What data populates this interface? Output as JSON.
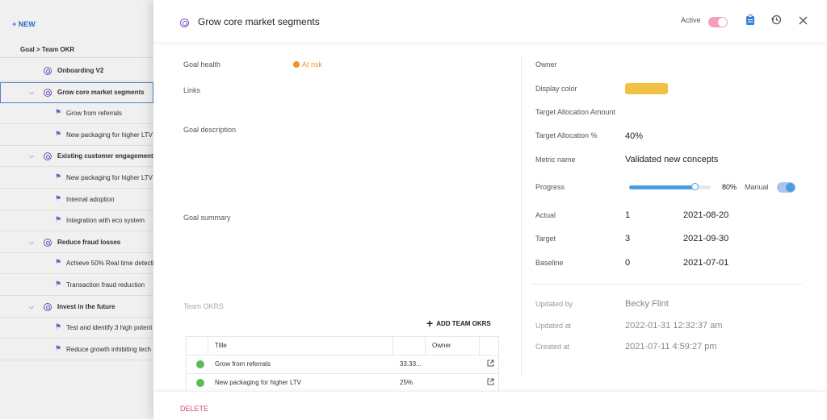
{
  "background": {
    "new_button": "+ NEW",
    "breadcrumb": "Goal > Team OKR",
    "tree": [
      {
        "type": "goal",
        "label": "Onboarding V2",
        "expandable": false
      },
      {
        "type": "goal",
        "label": "Grow core market segments",
        "expandable": true,
        "selected": true
      },
      {
        "type": "sub",
        "label": "Grow from referrals"
      },
      {
        "type": "sub",
        "label": "New packaging for higher LTV"
      },
      {
        "type": "goal",
        "label": "Existing customer engagement",
        "expandable": true
      },
      {
        "type": "sub",
        "label": "New packaging for higher LTV"
      },
      {
        "type": "sub",
        "label": "Internal adoption"
      },
      {
        "type": "sub",
        "label": "Integration with eco system"
      },
      {
        "type": "goal",
        "label": "Reduce fraud losses",
        "expandable": true
      },
      {
        "type": "sub",
        "label": "Achieve 50% Real time detecti"
      },
      {
        "type": "sub",
        "label": "Transaction fraud reduction"
      },
      {
        "type": "goal",
        "label": "Invest in the future",
        "expandable": true
      },
      {
        "type": "sub",
        "label": "Test and identify 3 high potent"
      },
      {
        "type": "sub",
        "label": "Reduce growth inhibiting tech"
      }
    ]
  },
  "header": {
    "title": "Grow core market segments",
    "active_label": "Active",
    "active_on": true
  },
  "left": {
    "goal_health_label": "Goal health",
    "goal_health_value": "At risk",
    "goal_health_color": "#f0922b",
    "links_label": "Links",
    "description_label": "Goal description",
    "summary_label": "Goal summary",
    "team_okrs_label": "Team OKRS",
    "add_team_okrs": "ADD TEAM OKRS",
    "table": {
      "headers": {
        "title": "Title",
        "owner": "Owner"
      },
      "rows": [
        {
          "status_color": "#5bbb52",
          "title": "Grow from referrals",
          "progress": "33.33..."
        },
        {
          "status_color": "#5bbb52",
          "title": "New packaging for higher LTV",
          "progress": "25%"
        }
      ]
    }
  },
  "right": {
    "owner_label": "Owner",
    "display_color_label": "Display color",
    "display_color": "#f2c044",
    "target_alloc_amount_label": "Target Allocation Amount",
    "target_alloc_pct_label": "Target Allocation %",
    "target_alloc_pct_value": "40%",
    "metric_name_label": "Metric name",
    "metric_name_value": "Validated new concepts",
    "progress_label": "Progress",
    "progress_value": 0.8,
    "progress_text": "80%",
    "manual_label": "Manual",
    "manual_on": true,
    "actual_label": "Actual",
    "actual_value": "1",
    "actual_date": "2021-08-20",
    "target_label": "Target",
    "target_value": "3",
    "target_date": "2021-09-30",
    "baseline_label": "Baseline",
    "baseline_value": "0",
    "baseline_date": "2021-07-01",
    "updated_by_label": "Updated by",
    "updated_by_value": "Becky Flint",
    "updated_at_label": "Updated at",
    "updated_at_value": "2022-01-31 12:32:37 am",
    "created_at_label": "Created at",
    "created_at_value": "2021-07-11 4:59:27 pm"
  },
  "footer": {
    "delete_label": "DELETE"
  }
}
